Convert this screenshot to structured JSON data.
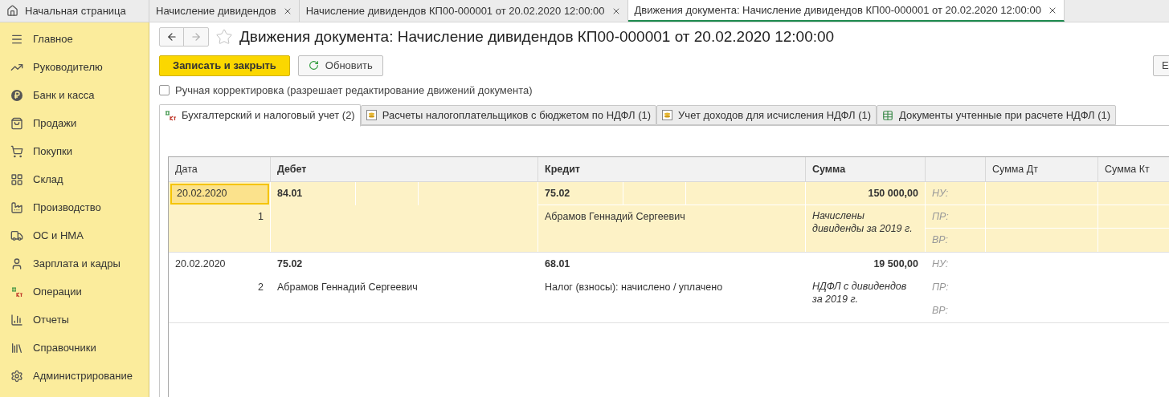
{
  "top_tabs": [
    {
      "label": "Начальная страница",
      "kind": "home",
      "selected": false
    },
    {
      "label": "Начисление дивидендов",
      "kind": "doc",
      "selected": false
    },
    {
      "label": "Начисление дивидендов КП00-000001 от 20.02.2020 12:00:00",
      "kind": "doc",
      "selected": false
    },
    {
      "label": "Движения документа: Начисление дивидендов КП00-000001 от 20.02.2020 12:00:00",
      "kind": "doc",
      "selected": true
    }
  ],
  "sidebar": {
    "items": [
      {
        "label": "Главное",
        "kind": "menu"
      },
      {
        "label": "Руководителю",
        "kind": "trend"
      },
      {
        "label": "Банк и касса",
        "kind": "coin"
      },
      {
        "label": "Продажи",
        "kind": "bag"
      },
      {
        "label": "Покупки",
        "kind": "cart"
      },
      {
        "label": "Склад",
        "kind": "grid"
      },
      {
        "label": "Производство",
        "kind": "factory"
      },
      {
        "label": "ОС и НМА",
        "kind": "truck"
      },
      {
        "label": "Зарплата и кадры",
        "kind": "user"
      },
      {
        "label": "Операции",
        "kind": "dtkt"
      },
      {
        "label": "Отчеты",
        "kind": "chart"
      },
      {
        "label": "Справочники",
        "kind": "books"
      },
      {
        "label": "Администрирование",
        "kind": "gear"
      }
    ]
  },
  "form": {
    "title": "Движения документа: Начисление дивидендов КП00-000001 от 20.02.2020 12:00:00",
    "favorite": false,
    "buttons": [
      {
        "label": "Записать и закрыть",
        "kind": "primary"
      },
      {
        "label": "Обновить",
        "kind": "refresh"
      },
      {
        "label": "Е",
        "kind": "more"
      }
    ],
    "manual_edit": {
      "label": "Ручная корректировка (разрешает редактирование движений документа)",
      "checked": false
    },
    "tabs": [
      {
        "label": "Бухгалтерский и налоговый учет (2)",
        "kind": "dtkt",
        "selected": true
      },
      {
        "label": "Расчеты налогоплательщиков с бюджетом по НДФЛ (1)",
        "kind": "register",
        "selected": false
      },
      {
        "label": "Учет доходов для исчисления НДФЛ (1)",
        "kind": "register",
        "selected": false
      },
      {
        "label": "Документы учтенные при расчете НДФЛ (1)",
        "kind": "table",
        "selected": false
      }
    ]
  },
  "table": {
    "columns": [
      "Дата",
      "Дебет",
      "Кредит",
      "Сумма",
      "Сумма Дт",
      "Сумма Кт"
    ],
    "rows": [
      {
        "date": "20.02.2020",
        "number": "1",
        "debit": "84.01",
        "debit_subconto": "",
        "credit": "75.02",
        "credit_subconto": "Абрамов Геннадий Сергеевич",
        "amount": "150 000,00",
        "content": "Начислены дивиденды за 2019 г.",
        "labels": [
          "НУ:",
          "ПР:",
          "ВР:"
        ],
        "selected": true
      },
      {
        "date": "20.02.2020",
        "number": "2",
        "debit": "75.02",
        "debit_subconto": "Абрамов Геннадий Сергеевич",
        "credit": "68.01",
        "credit_subconto": "Налог (взносы): начислено / уплачено",
        "amount": "19 500,00",
        "content": "НДФЛ с дивидендов за 2019 г.",
        "labels": [
          "НУ:",
          "ПР:",
          "ВР:"
        ],
        "selected": false
      }
    ]
  }
}
